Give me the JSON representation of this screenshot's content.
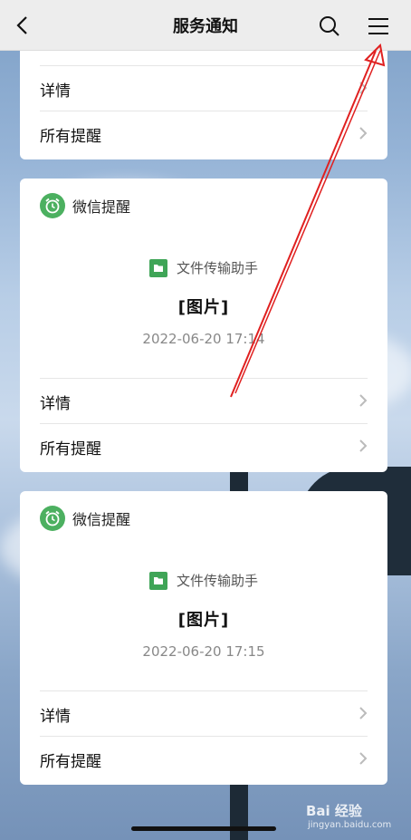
{
  "navbar": {
    "title": "服务通知",
    "back_icon": "chevron-left-icon",
    "search_icon": "search-icon",
    "menu_icon": "menu-icon"
  },
  "top_card": {
    "rows": [
      {
        "label": "详情"
      },
      {
        "label": "所有提醒"
      }
    ]
  },
  "cards": [
    {
      "app_name": "微信提醒",
      "sender": "文件传输助手",
      "message": "[图片]",
      "time": "2022-06-20 17:14",
      "rows": [
        {
          "label": "详情"
        },
        {
          "label": "所有提醒"
        }
      ]
    },
    {
      "app_name": "微信提醒",
      "sender": "文件传输助手",
      "message": "[图片]",
      "time": "2022-06-20 17:15",
      "rows": [
        {
          "label": "详情"
        },
        {
          "label": "所有提醒"
        }
      ]
    }
  ],
  "watermark": {
    "brand": "Bai 经验",
    "url": "jingyan.baidu.com"
  },
  "colors": {
    "accent_green": "#4cb060",
    "annotation_red": "#e02020"
  }
}
